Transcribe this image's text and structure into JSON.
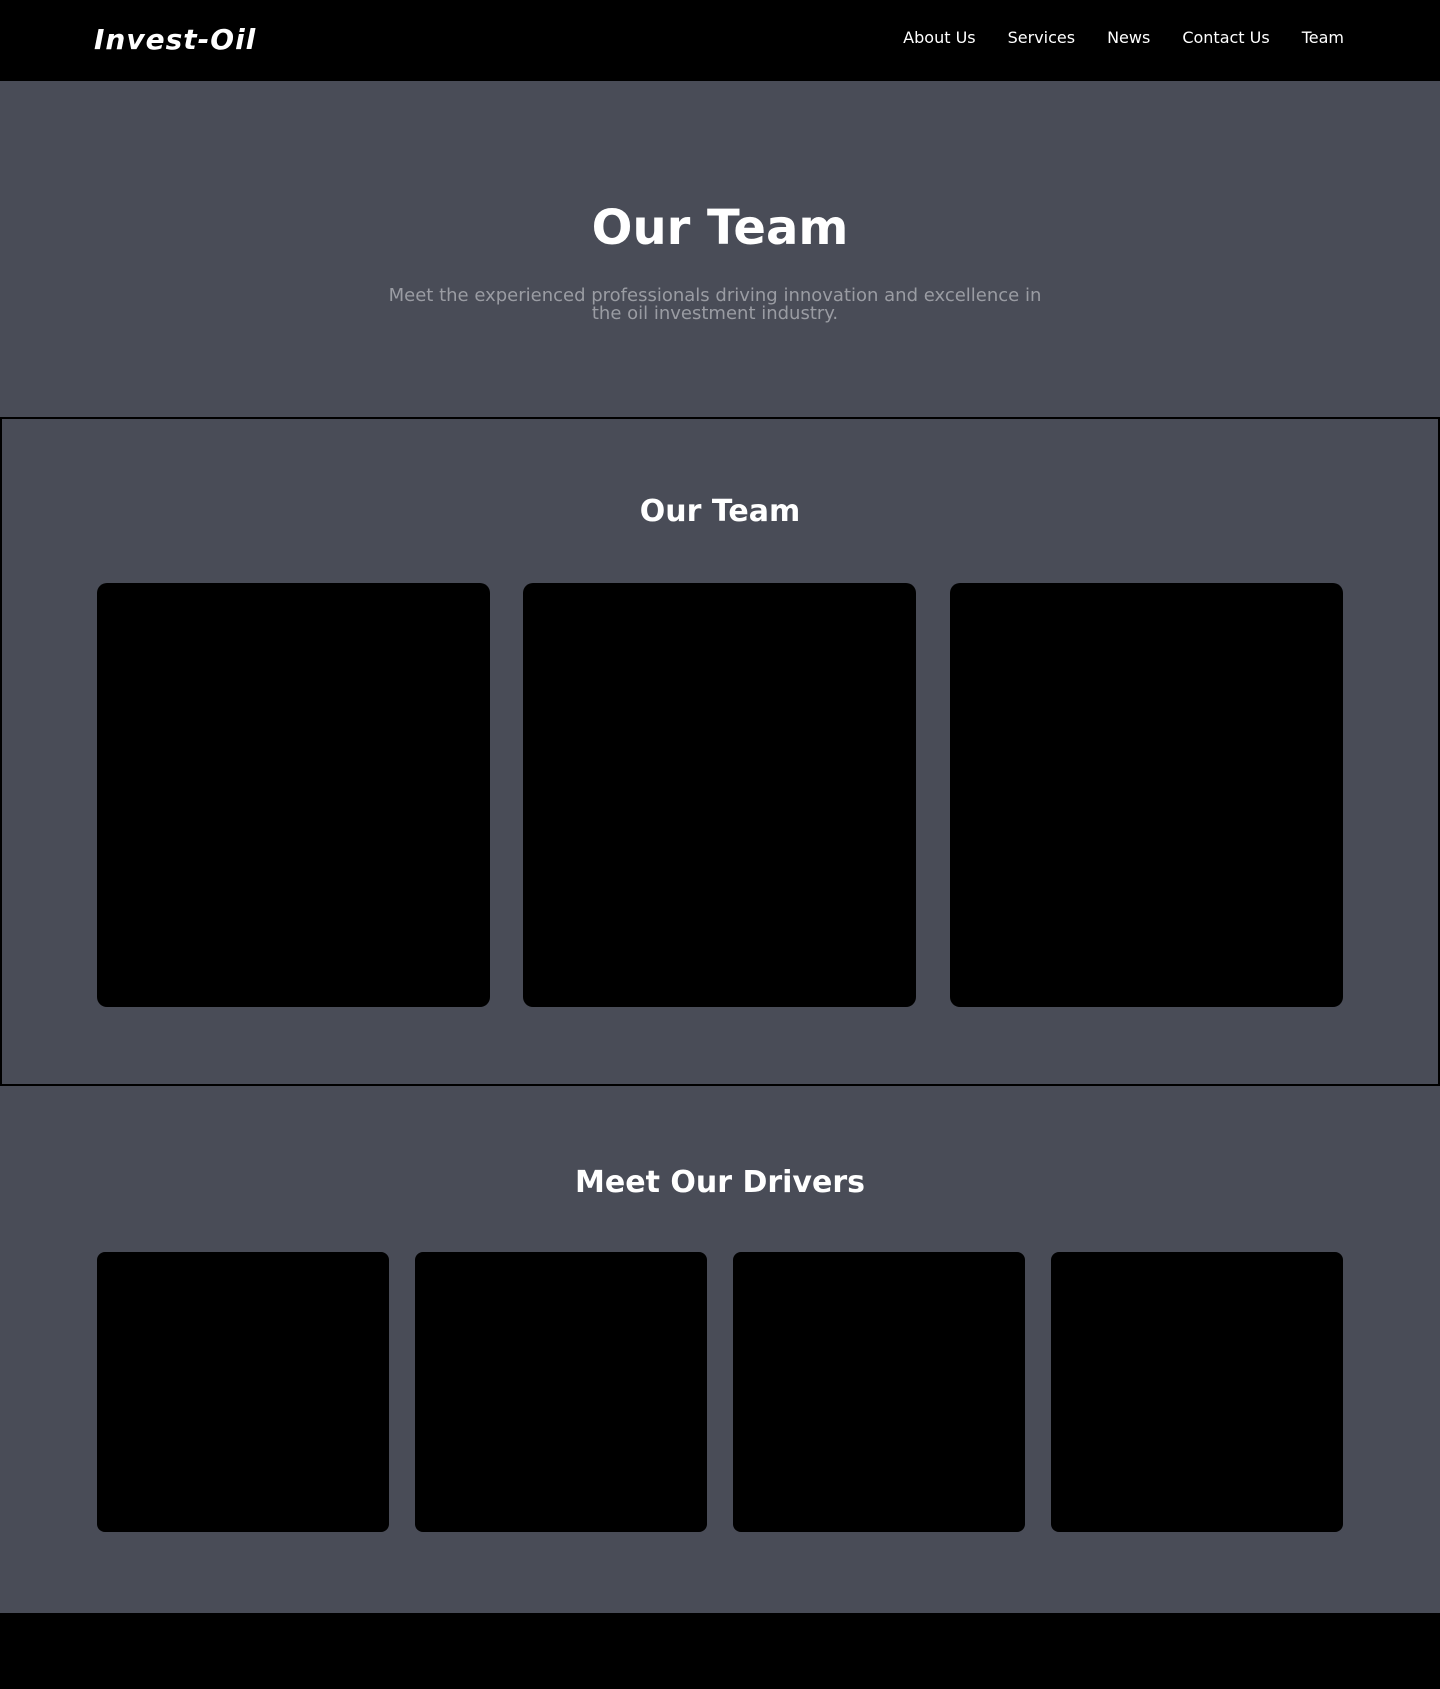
{
  "header": {
    "logo": "Invest-Oil",
    "nav": [
      {
        "label": "About Us"
      },
      {
        "label": "Services"
      },
      {
        "label": "News"
      },
      {
        "label": "Contact Us"
      },
      {
        "label": "Team"
      }
    ]
  },
  "hero": {
    "title": "Our Team",
    "subtitle": "Meet the experienced professionals driving innovation and excellence in the oil investment industry."
  },
  "team_section": {
    "title": "Our Team",
    "card_count": 3
  },
  "drivers_section": {
    "title": "Meet Our Drivers",
    "card_count": 4
  },
  "colors": {
    "page_background": "#494c57",
    "header_background": "#000000",
    "card_background": "#000000",
    "text_primary": "#ffffff",
    "text_muted": "#9a9ca3"
  }
}
